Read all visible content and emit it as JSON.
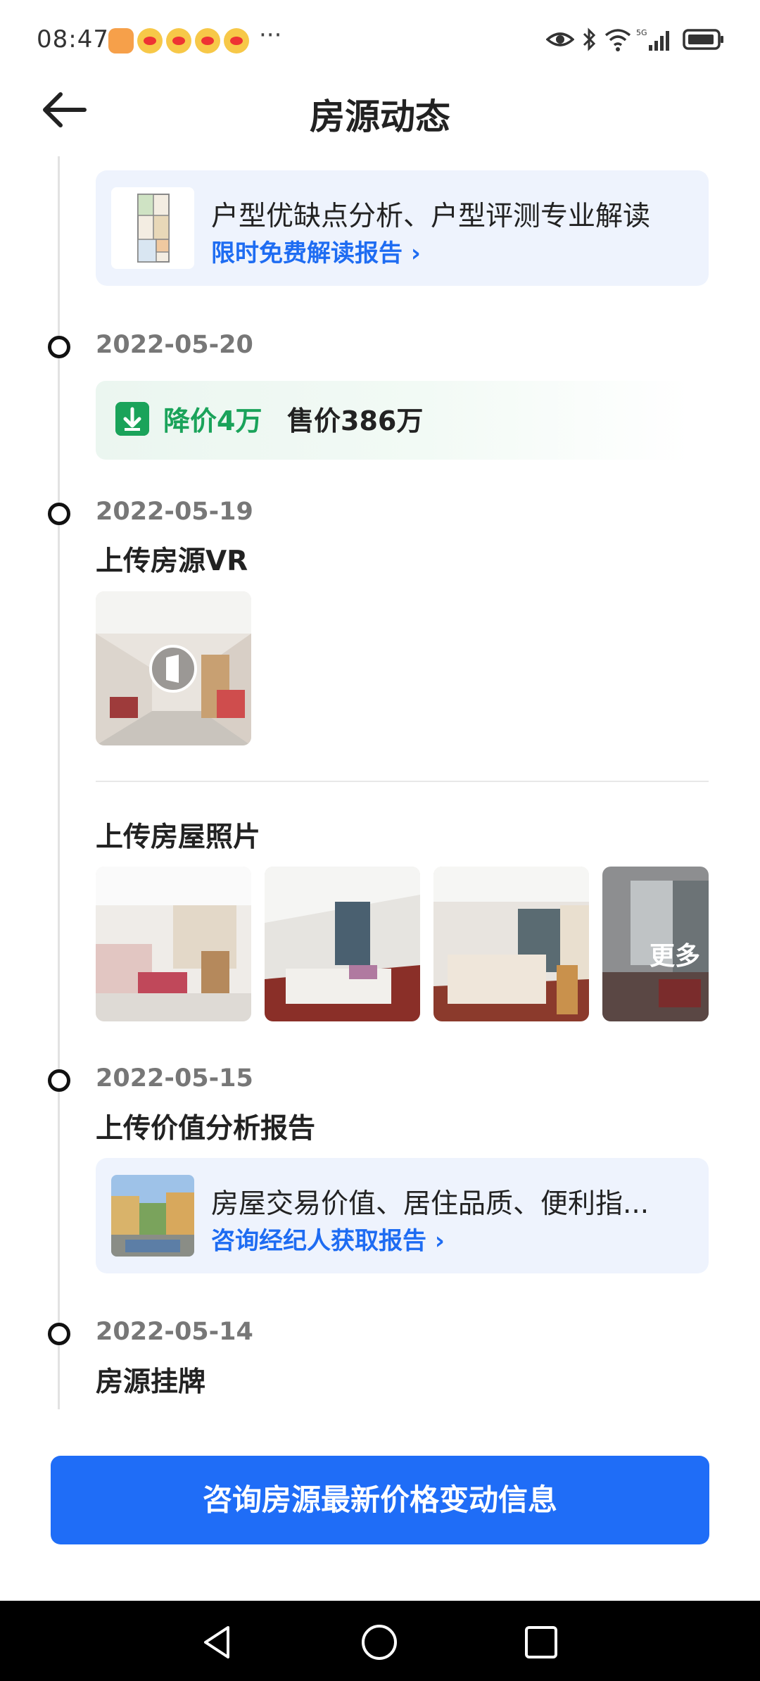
{
  "status_bar": {
    "time": "08:47",
    "more": "···"
  },
  "header": {
    "title": "房源动态"
  },
  "layout_card": {
    "title": "户型优缺点分析、户型评测专业解读",
    "link": "限时免费解读报告 ›"
  },
  "timeline": [
    {
      "date": "2022-05-20",
      "price_drop": "降价4万",
      "price_now": "售价386万"
    },
    {
      "date": "2022-05-19",
      "title_vr": "上传房源VR",
      "title_photos": "上传房屋照片",
      "more_label": "更多"
    },
    {
      "date": "2022-05-15",
      "title": "上传价值分析报告",
      "card_title": "房屋交易价值、居住品质、便利指...",
      "card_link": "咨询经纪人获取报告 ›"
    },
    {
      "date": "2022-05-14",
      "title": "房源挂牌"
    }
  ],
  "cta": {
    "label": "咨询房源最新价格变动信息"
  },
  "colors": {
    "accent": "#1f6df7",
    "price_drop": "#1aa35a",
    "card_bg": "#eef3fd"
  }
}
